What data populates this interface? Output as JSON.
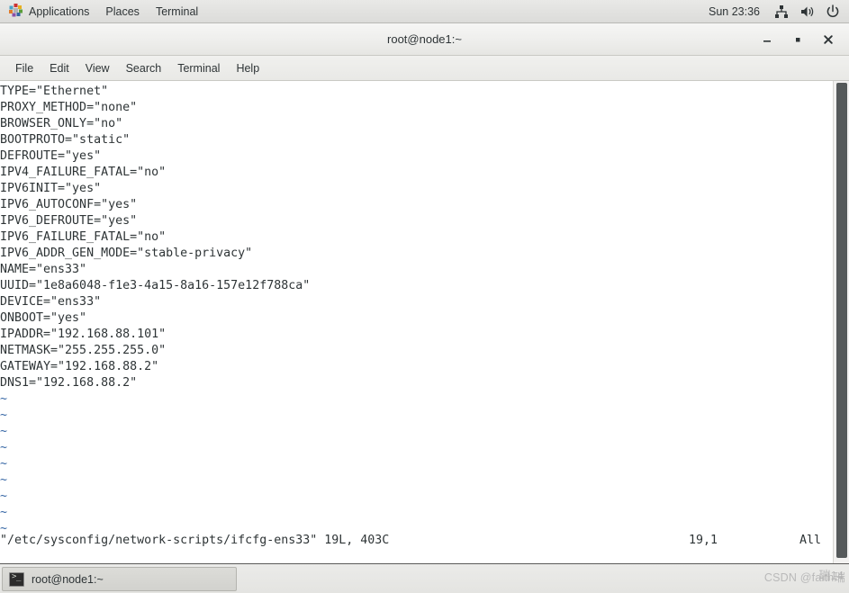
{
  "top_panel": {
    "applications_label": "Applications",
    "places_label": "Places",
    "terminal_label": "Terminal",
    "clock": "Sun 23:36",
    "icons": {
      "applications": "gnome-foot-icon",
      "network": "network-icon",
      "volume": "volume-icon",
      "power": "power-icon"
    }
  },
  "window": {
    "title": "root@node1:~",
    "minimize_label": "–",
    "maximize_label": "▪",
    "close_label": "✕"
  },
  "menubar": {
    "items": [
      {
        "label": "File"
      },
      {
        "label": "Edit"
      },
      {
        "label": "View"
      },
      {
        "label": "Search"
      },
      {
        "label": "Terminal"
      },
      {
        "label": "Help"
      }
    ]
  },
  "terminal": {
    "lines": [
      "TYPE=\"Ethernet\"",
      "PROXY_METHOD=\"none\"",
      "BROWSER_ONLY=\"no\"",
      "BOOTPROTO=\"static\"",
      "DEFROUTE=\"yes\"",
      "IPV4_FAILURE_FATAL=\"no\"",
      "IPV6INIT=\"yes\"",
      "IPV6_AUTOCONF=\"yes\"",
      "IPV6_DEFROUTE=\"yes\"",
      "IPV6_FAILURE_FATAL=\"no\"",
      "IPV6_ADDR_GEN_MODE=\"stable-privacy\"",
      "NAME=\"ens33\"",
      "UUID=\"1e8a6048-f1e3-4a15-8a16-157e12f788ca\"",
      "DEVICE=\"ens33\"",
      "ONBOOT=\"yes\"",
      "IPADDR=\"192.168.88.101\"",
      "NETMASK=\"255.255.255.0\"",
      "GATEWAY=\"192.168.88.2\"",
      "DNS1=\"192.168.88.2\""
    ],
    "empty_marker": "~",
    "empty_marker_count": 9,
    "status": {
      "file": "\"/etc/sysconfig/network-scripts/ifcfg-ens33\" 19L, 403C",
      "position": "19,1",
      "percent": "All"
    }
  },
  "bottom_panel": {
    "task_label": "root@node1:~",
    "task_icon": "terminal-icon"
  },
  "watermark": {
    "text": "CSDN @faith瑞",
    "overlay": "瑞14"
  },
  "colors": {
    "panel_bg": "#e4e4e1",
    "terminal_bg": "#ffffff",
    "terminal_fg": "#2e3436",
    "tilde_blue": "#3465a4",
    "scrollbar_thumb": "#55595a"
  }
}
